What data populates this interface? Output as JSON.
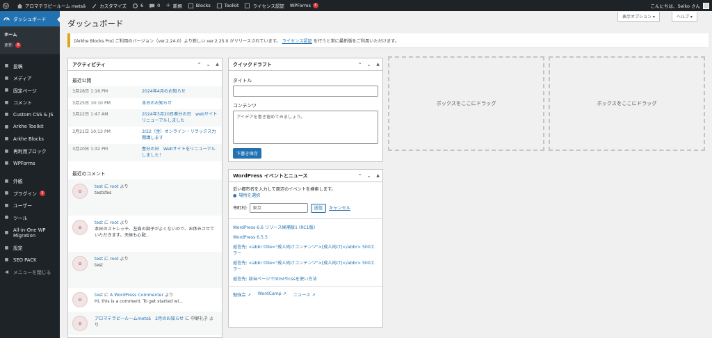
{
  "adminbar": {
    "site_name": "アロマテラピールーム metsä",
    "customize": "カスタマイズ",
    "updates_count": "6",
    "comments_count": "0",
    "new_label": "新規",
    "blocks": "Blocks",
    "toolkit": "Toolkit",
    "license": "ライセンス認証",
    "wpforms": "WPForms",
    "wpforms_badge": "6",
    "greeting": "こんにちは、Seiko さん"
  },
  "sidebar": {
    "dashboard": "ダッシュボード",
    "submenu": {
      "home": "ホーム",
      "updates": "更新",
      "updates_badge": "6"
    },
    "items": [
      {
        "label": "投稿",
        "icon": "pin-icon"
      },
      {
        "label": "メディア",
        "icon": "media-icon"
      },
      {
        "label": "固定ページ",
        "icon": "page-icon"
      },
      {
        "label": "コメント",
        "icon": "comment-icon"
      },
      {
        "label": "Custom CSS & JS",
        "icon": "plus-icon"
      },
      {
        "label": "Arkhe Toolkit",
        "icon": "arkhe-icon"
      },
      {
        "label": "Arkhe Blocks",
        "icon": "arkhe-icon"
      },
      {
        "label": "再利用ブロック",
        "icon": "block-icon"
      },
      {
        "label": "WPForms",
        "icon": "forms-icon"
      }
    ],
    "items2": [
      {
        "label": "外観",
        "icon": "brush-icon"
      },
      {
        "label": "プラグイン",
        "icon": "plugin-icon",
        "badge": "5"
      },
      {
        "label": "ユーザー",
        "icon": "user-icon"
      },
      {
        "label": "ツール",
        "icon": "tool-icon"
      },
      {
        "label": "All-in-One WP Migration",
        "icon": "migration-icon"
      },
      {
        "label": "設定",
        "icon": "settings-icon"
      },
      {
        "label": "SEO PACK",
        "icon": "seo-icon"
      }
    ],
    "collapse": "メニューを閉じる"
  },
  "header": {
    "title": "ダッシュボード",
    "screen_options": "表示オプション ▾",
    "help": "ヘルプ ▾"
  },
  "notice": {
    "text_before": "[Arkhe Blocks Pro] ご利用のバージョン（ver.2.24.0）より新しい ver.2.25.0 がリリースされています。",
    "link": "ライセンス認証",
    "text_after": "を行うと常に最新版をご利用いただけます。"
  },
  "activity": {
    "title": "アクティビティ",
    "recent_published": "最近公開",
    "posts": [
      {
        "date": "3月28日 1:16 PM",
        "title": "2024年4月のお知らせ"
      },
      {
        "date": "3月25日 10:10 PM",
        "title": "本日のお知らせ"
      },
      {
        "date": "3月22日 1:47 AM",
        "title": "2024年3月20日春分の日　webサイトリニューアルしました"
      },
      {
        "date": "3月21日 10:13 PM",
        "title": "3/22（金）オンライン・リラックス力開講します"
      },
      {
        "date": "3月20日 1:32 PM",
        "title": "春分の日　Webサイトをリニューアルしました！"
      }
    ],
    "recent_comments": "最近のコメント",
    "comments": [
      {
        "meta_pre": "",
        "author": "test",
        "mid": " に ",
        "post": "root",
        "meta_post": " より",
        "text": "testsfes"
      },
      {
        "meta_pre": "",
        "author": "test",
        "mid": " に ",
        "post": "root",
        "meta_post": " より",
        "text": "本日のストレッチ、左肩の調子がよくないので、お休みさせていただきます。天候も心配..."
      },
      {
        "meta_pre": "",
        "author": "test",
        "mid": " に ",
        "post": "root",
        "meta_post": " より",
        "text": "test"
      },
      {
        "meta_pre": "",
        "author": "test",
        "mid": " に ",
        "post": "A WordPress Commenter",
        "meta_post": " より",
        "text": "Hi, this is a comment. To get started wi..."
      },
      {
        "meta_pre": "",
        "author": "アロマテラピールームmetsä",
        "mid": "　",
        "post": "2月のお知らせ",
        "meta_post": " に 中野礼子 より",
        "text": ""
      }
    ]
  },
  "quickdraft": {
    "title": "クイックドラフト",
    "title_label": "タイトル",
    "content_label": "コンテンツ",
    "content_placeholder": "アイデアを書き留めてみましょう。",
    "save_button": "下書き保存"
  },
  "events": {
    "title": "WordPress イベントとニュース",
    "intro": "近い都市名を入力して周辺のイベントを検索します。",
    "select_location": "場所を選択",
    "city_label": "市町村:",
    "city_value": "東京",
    "submit": "送信",
    "cancel": "キャンセル",
    "news": [
      "WordPress 6.6 リリース候補版1 (RC1版)",
      "WordPress 6.5.5",
      "返信先: <abbr title=\"成人向けコンテンツ\">[成人向け]</abbr> 500エラー",
      "返信先: <abbr title=\"成人向けコンテンツ\">[成人向け]</abbr> 500エラー",
      "返信先: 該当ページでhtmlやcssを使い方法"
    ],
    "footer": {
      "meetups": "勉強会",
      "wordcamp": "WordCamp",
      "news": "ニュース"
    }
  },
  "dropzones": {
    "left": "ボックスをここにドラッグ",
    "right": "ボックスをここにドラッグ"
  },
  "colors": {
    "adminbar": "#1d2327",
    "accent": "#2271b1",
    "badge": "#d63638",
    "notice": "#dba617"
  }
}
